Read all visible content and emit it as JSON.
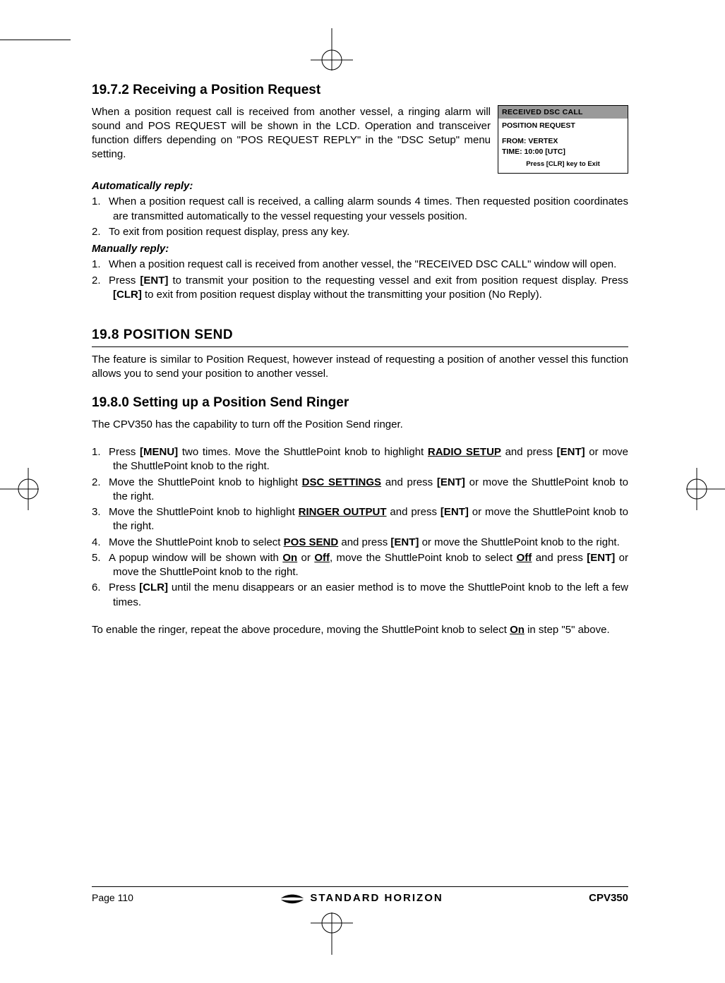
{
  "section1": {
    "heading": "19.7.2 Receiving a Position Request",
    "intro": "When a position request call is received from another vessel, a ringing alarm will sound and POS REQUEST will be shown in the LCD. Operation and transceiver function differs depending on \"POS REQUEST REPLY\" in the \"DSC Setup\" menu setting.",
    "lcd": {
      "title": "RECEIVED DSC CALL",
      "sub": "POSITION REQUEST",
      "from": "FROM: VERTEX",
      "time": "TIME: 10:00 [UTC]",
      "foot": "Press [CLR] key to Exit"
    },
    "auto_label": "Automatically reply:",
    "auto_items": [
      "When a position request call is received, a calling alarm sounds 4 times. Then requested position coordinates are transmitted automatically to the vessel requesting your vessels position.",
      "To exit from position request display, press any key."
    ],
    "manual_label": "Manually reply:",
    "manual_items": {
      "i1": "When a position request call is received from another vessel, the \"RECEIVED DSC CALL\" window will open.",
      "i2_a": "Press ",
      "i2_ent": "[ENT]",
      "i2_b": " to transmit your position to the requesting vessel and exit from position request display. Press ",
      "i2_clr": "[CLR]",
      "i2_c": " to exit from position request display without the transmitting your position (No Reply)."
    }
  },
  "section2": {
    "heading": "19.8   POSITION SEND",
    "intro": "The feature is similar to Position Request, however instead of requesting a position of another vessel this function allows you to send your position to another vessel."
  },
  "section3": {
    "heading": "19.8.0 Setting up a Position Send Ringer",
    "intro": "The CPV350 has the capability to turn off the Position Send ringer.",
    "step1": {
      "a": "Press ",
      "menu": "[MENU]",
      "b": " two times. Move the ShuttlePoint knob to highlight ",
      "hl": "RADIO SETUP",
      "c": " and press ",
      "ent": "[ENT]",
      "d": " or move the ShuttlePoint knob to the right."
    },
    "step2": {
      "a": "Move the ShuttlePoint knob to highlight ",
      "hl": "DSC SETTINGS",
      "b": " and press ",
      "ent": "[ENT]",
      "c": " or move the ShuttlePoint knob to the right."
    },
    "step3": {
      "a": "Move the ShuttlePoint knob to highlight ",
      "hl": "RINGER OUTPUT",
      "b": " and press ",
      "ent": "[ENT]",
      "c": " or move the ShuttlePoint knob to the right."
    },
    "step4": {
      "a": "Move the ShuttlePoint knob to select ",
      "hl": "POS SEND",
      "b": " and press ",
      "ent": "[ENT]",
      "c": " or move the ShuttlePoint knob to the right."
    },
    "step5": {
      "a": "A popup window will be shown with ",
      "on": "On",
      "b": " or ",
      "off": "Off",
      "c": ", move the ShuttlePoint knob to select ",
      "off2": "Off",
      "d": " and press ",
      "ent": "[ENT]",
      "e": " or move the ShuttlePoint knob to the right."
    },
    "step6": {
      "a": "Press ",
      "clr": "[CLR]",
      "b": " until the menu disappears or an easier method is to move the ShuttlePoint knob to the left a few times."
    },
    "outro_a": "To enable the ringer, repeat the above procedure, moving the ShuttlePoint knob to select ",
    "outro_on": "On",
    "outro_b": " in step \"5\" above."
  },
  "footer": {
    "page": "Page 110",
    "brand": "STANDARD HORIZON",
    "model": "CPV350"
  }
}
